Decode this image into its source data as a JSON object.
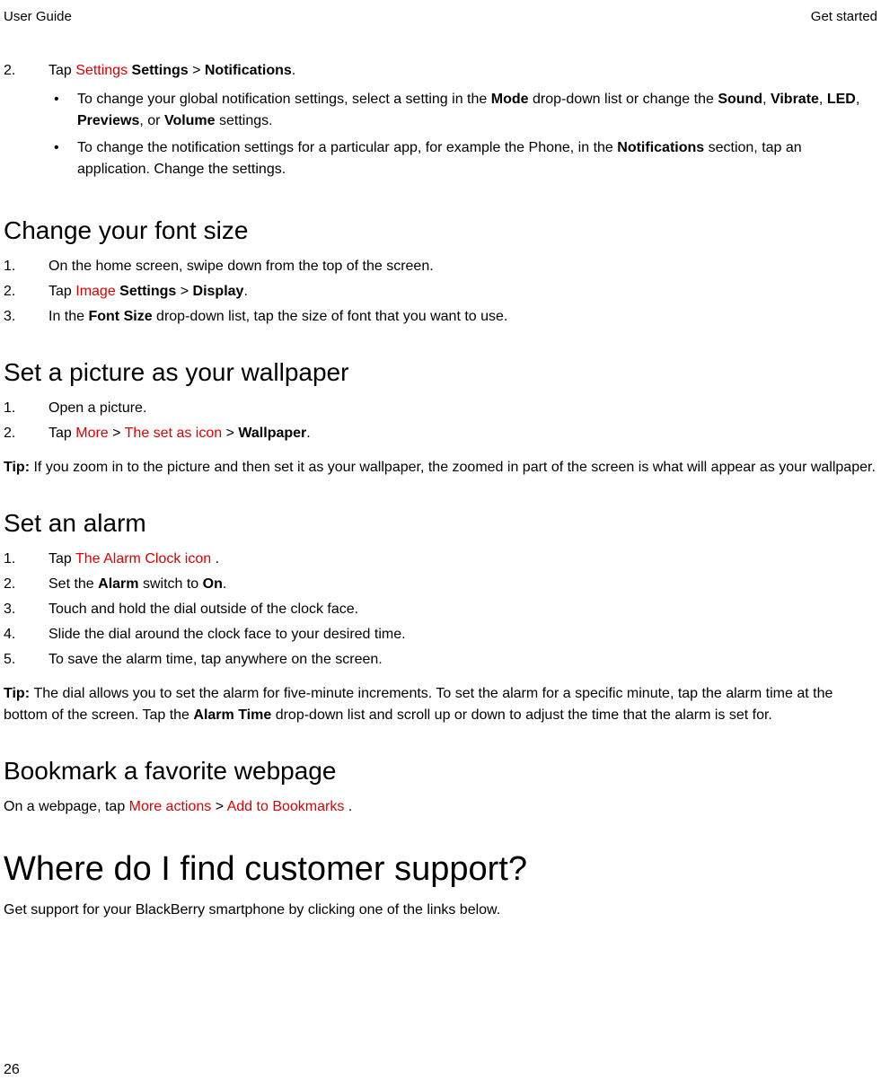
{
  "header": {
    "left": "User Guide",
    "right": "Get started"
  },
  "page_number": "26",
  "intro_step": {
    "num": "2.",
    "pre": "Tap ",
    "red": "Settings",
    "after": " ",
    "b1": "Settings",
    "sep": " > ",
    "b2": "Notifications",
    "end": "."
  },
  "intro_bullets": [
    {
      "pre": "To change your global notification settings, select a setting in the ",
      "b1": "Mode",
      "mid1": " drop-down list or change the ",
      "b2": "Sound",
      "mid2": ", ",
      "b3": "Vibrate",
      "mid3": ", ",
      "b4": "LED",
      "mid4": ", ",
      "b5": "Previews",
      "mid5": ", or ",
      "b6": "Volume",
      "end": " settings."
    },
    {
      "pre": "To change the notification settings for a particular app, for example the Phone, in the ",
      "b1": "Notifications",
      "end": " section, tap an application. Change the settings."
    }
  ],
  "sections": {
    "font": {
      "heading": "Change your font size",
      "steps": [
        {
          "num": "1.",
          "text": "On the home screen, swipe down from the top of the screen."
        },
        {
          "num": "2.",
          "pre": "Tap ",
          "red": "Image",
          "after": " ",
          "b1": "Settings",
          "sep": " > ",
          "b2": "Display",
          "end": "."
        },
        {
          "num": "3.",
          "pre": "In the ",
          "b1": "Font Size",
          "end": " drop-down list, tap the size of font that you want to use."
        }
      ]
    },
    "wallpaper": {
      "heading": "Set a picture as your wallpaper",
      "steps": [
        {
          "num": "1.",
          "text": "Open a picture."
        },
        {
          "num": "2.",
          "pre": "Tap ",
          "red1": "More",
          "sep1": " > ",
          "red2": "The set as icon",
          "sep2": " > ",
          "b1": "Wallpaper",
          "end": "."
        }
      ],
      "tip_label": "Tip: ",
      "tip_text": "If you zoom in to the picture and then set it as your wallpaper, the zoomed in part of the screen is what will appear as your wallpaper."
    },
    "alarm": {
      "heading": "Set an alarm",
      "steps": [
        {
          "num": "1.",
          "pre": "Tap ",
          "red": "The Alarm Clock icon",
          "end": " ."
        },
        {
          "num": "2.",
          "pre": "Set the ",
          "b1": "Alarm",
          "mid": " switch to ",
          "b2": "On",
          "end": "."
        },
        {
          "num": "3.",
          "text": "Touch and hold the dial outside of the clock face."
        },
        {
          "num": "4.",
          "text": "Slide the dial around the clock face to your desired time."
        },
        {
          "num": "5.",
          "text": "To save the alarm time, tap anywhere on the screen."
        }
      ],
      "tip_label": "Tip: ",
      "tip_pre": "The dial allows you to set the alarm for five-minute increments. To set the alarm for a specific minute, tap the alarm time at the bottom of the screen. Tap the ",
      "tip_b1": "Alarm Time",
      "tip_end": " drop-down list and scroll up or down to adjust the time that the alarm is set for."
    },
    "bookmark": {
      "heading": "Bookmark a favorite webpage",
      "pre": "On a webpage, tap ",
      "red1": "More actions",
      "sep": " > ",
      "red2": "Add to Bookmarks",
      "end": " ."
    },
    "support": {
      "heading": "Where do I find customer support?",
      "text": "Get support for your BlackBerry smartphone by clicking one of the links below."
    }
  }
}
